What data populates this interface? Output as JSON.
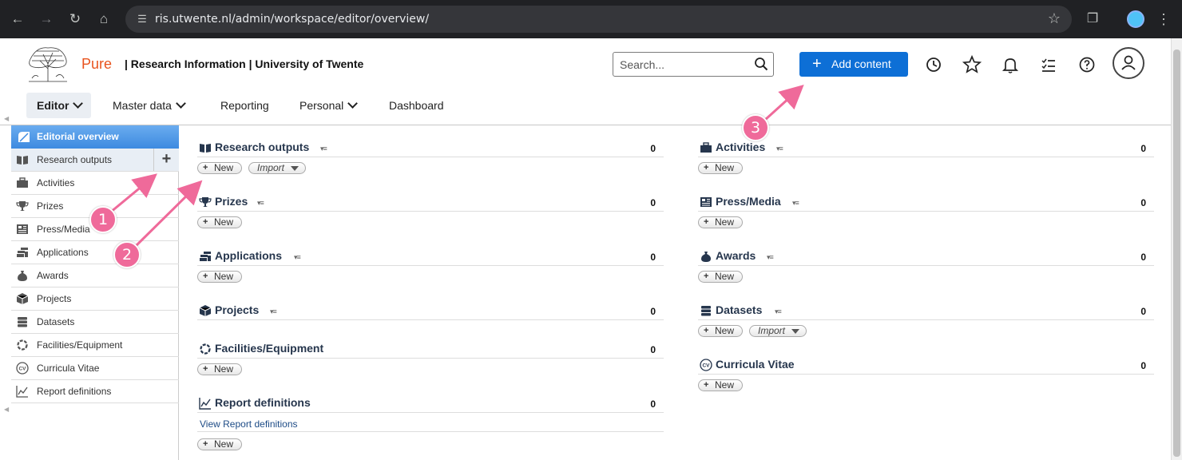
{
  "browser": {
    "url": "ris.utwente.nl/admin/workspace/editor/overview/"
  },
  "header": {
    "brand": "Pure",
    "subtitle": "| Research Information | University of Twente",
    "search_placeholder": "Search...",
    "add_content_label": "Add content"
  },
  "nav": {
    "items": [
      "Editor",
      "Master data",
      "Reporting",
      "Personal",
      "Dashboard"
    ]
  },
  "sidebar": {
    "heading": "Editorial overview",
    "items": [
      {
        "label": "Research outputs",
        "icon": "book-icon"
      },
      {
        "label": "Activities",
        "icon": "briefcase-icon"
      },
      {
        "label": "Prizes",
        "icon": "trophy-icon"
      },
      {
        "label": "Press/Media",
        "icon": "newspaper-icon"
      },
      {
        "label": "Applications",
        "icon": "coins-icon"
      },
      {
        "label": "Awards",
        "icon": "money-bag-icon"
      },
      {
        "label": "Projects",
        "icon": "cube-icon"
      },
      {
        "label": "Datasets",
        "icon": "database-icon"
      },
      {
        "label": "Facilities/Equipment",
        "icon": "ring-icon"
      },
      {
        "label": "Curricula Vitae",
        "icon": "cv-icon"
      },
      {
        "label": "Report definitions",
        "icon": "chart-icon"
      }
    ]
  },
  "sections": {
    "research_outputs": {
      "title": "Research outputs",
      "count": "0",
      "new": "New",
      "import": "Import"
    },
    "prizes": {
      "title": "Prizes",
      "count": "0",
      "new": "New"
    },
    "applications": {
      "title": "Applications",
      "count": "0",
      "new": "New"
    },
    "projects": {
      "title": "Projects",
      "count": "0"
    },
    "facilities": {
      "title": "Facilities/Equipment",
      "count": "0",
      "new": "New"
    },
    "report_definitions": {
      "title": "Report definitions",
      "count": "0",
      "link": "View Report definitions",
      "new": "New"
    },
    "activities": {
      "title": "Activities",
      "count": "0",
      "new": "New"
    },
    "press_media": {
      "title": "Press/Media",
      "count": "0",
      "new": "New"
    },
    "awards": {
      "title": "Awards",
      "count": "0",
      "new": "New"
    },
    "datasets": {
      "title": "Datasets",
      "count": "0",
      "new": "New",
      "import": "Import"
    },
    "curricula_vitae": {
      "title": "Curricula Vitae",
      "count": "0",
      "new": "New"
    }
  },
  "annotations": {
    "badge_1": "1",
    "badge_2": "2",
    "badge_3": "3",
    "color": "#ef6a9a"
  }
}
